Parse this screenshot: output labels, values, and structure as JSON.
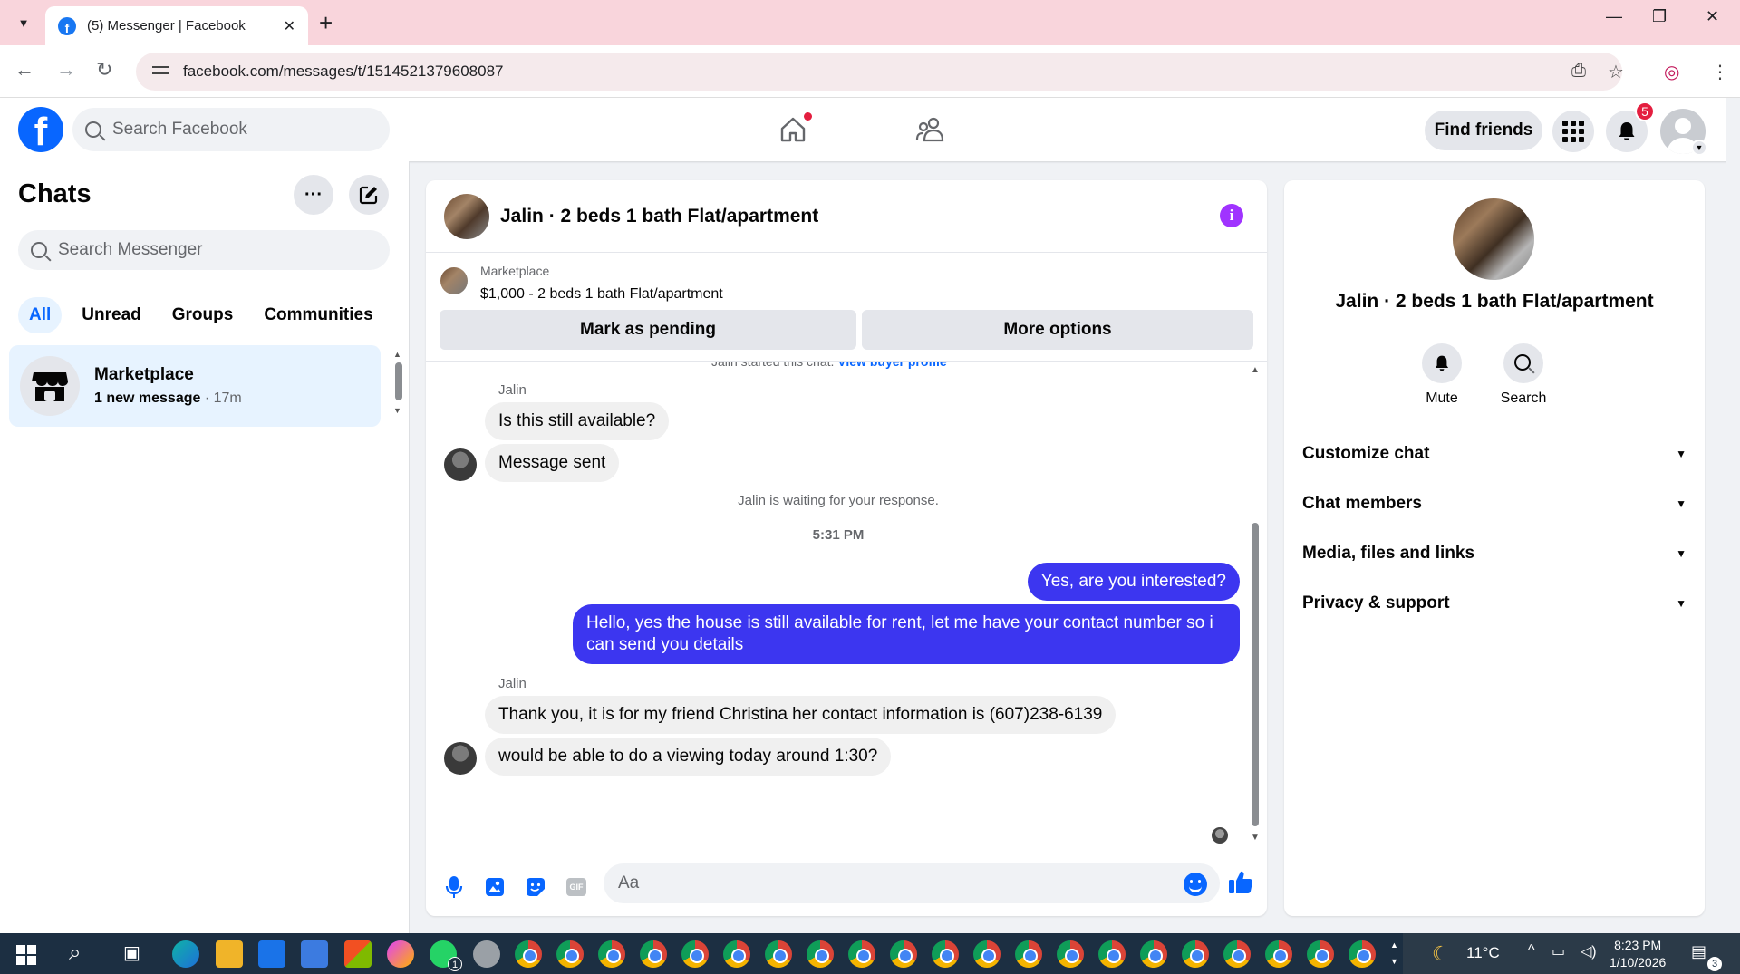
{
  "browser": {
    "tab_title": "(5) Messenger | Facebook",
    "url": "facebook.com/messages/t/1514521379608087",
    "new_tab_symbol": "+"
  },
  "fb_header": {
    "search_placeholder": "Search Facebook",
    "find_friends_label": "Find friends",
    "notification_count": "5",
    "colors": {
      "brand": "#0866ff",
      "badge": "#e41e3f"
    }
  },
  "sidebar": {
    "title": "Chats",
    "search_placeholder": "Search Messenger",
    "filters": [
      "All",
      "Unread",
      "Groups",
      "Communities"
    ],
    "active_filter": "All",
    "chats": [
      {
        "name": "Marketplace",
        "preview": "1 new message",
        "time": "17m"
      }
    ]
  },
  "conversation": {
    "title": "Jalin · 2 beds 1 bath Flat/apartment",
    "listing": {
      "source": "Marketplace",
      "price_title": "$1,000 - 2 beds 1 bath Flat/apartment",
      "mark_pending_label": "Mark as pending",
      "more_options_label": "More options"
    },
    "partial_line": {
      "text": "Jalin started this chat.",
      "link": "View buyer profile"
    },
    "messages": [
      {
        "sender": "Jalin",
        "text": "Is this still available?",
        "dir": "in"
      },
      {
        "text": "Message sent",
        "dir": "in"
      },
      {
        "system": "Jalin is waiting for your response."
      },
      {
        "time": "5:31 PM"
      },
      {
        "text": "Yes, are you interested?",
        "dir": "out"
      },
      {
        "text": "Hello, yes the house is still available for rent, let me have your contact number so i can send you details",
        "dir": "out"
      },
      {
        "sender": "Jalin",
        "text": "Thank you, it is for my friend Christina her contact information is (607)238-6139",
        "dir": "in"
      },
      {
        "text": "would be able to do a viewing today around 1:30?",
        "dir": "in"
      }
    ],
    "composer_placeholder": "Aa",
    "gif_label": "GIF",
    "colors": {
      "outgoing_bubble": "#3c36f0",
      "incoming_bubble": "#f0f0f0",
      "info_icon": "#a033ff"
    }
  },
  "info_panel": {
    "name": "Jalin · 2 beds 1 bath Flat/apartment",
    "actions": [
      "Mute",
      "Search"
    ],
    "sections": [
      "Customize chat",
      "Chat members",
      "Media, files and links",
      "Privacy & support"
    ]
  },
  "taskbar": {
    "weather": "11°C",
    "time": "8:23 PM",
    "date": "1/10/2026",
    "whatsapp_badge": "1",
    "notification_badge": "3"
  }
}
